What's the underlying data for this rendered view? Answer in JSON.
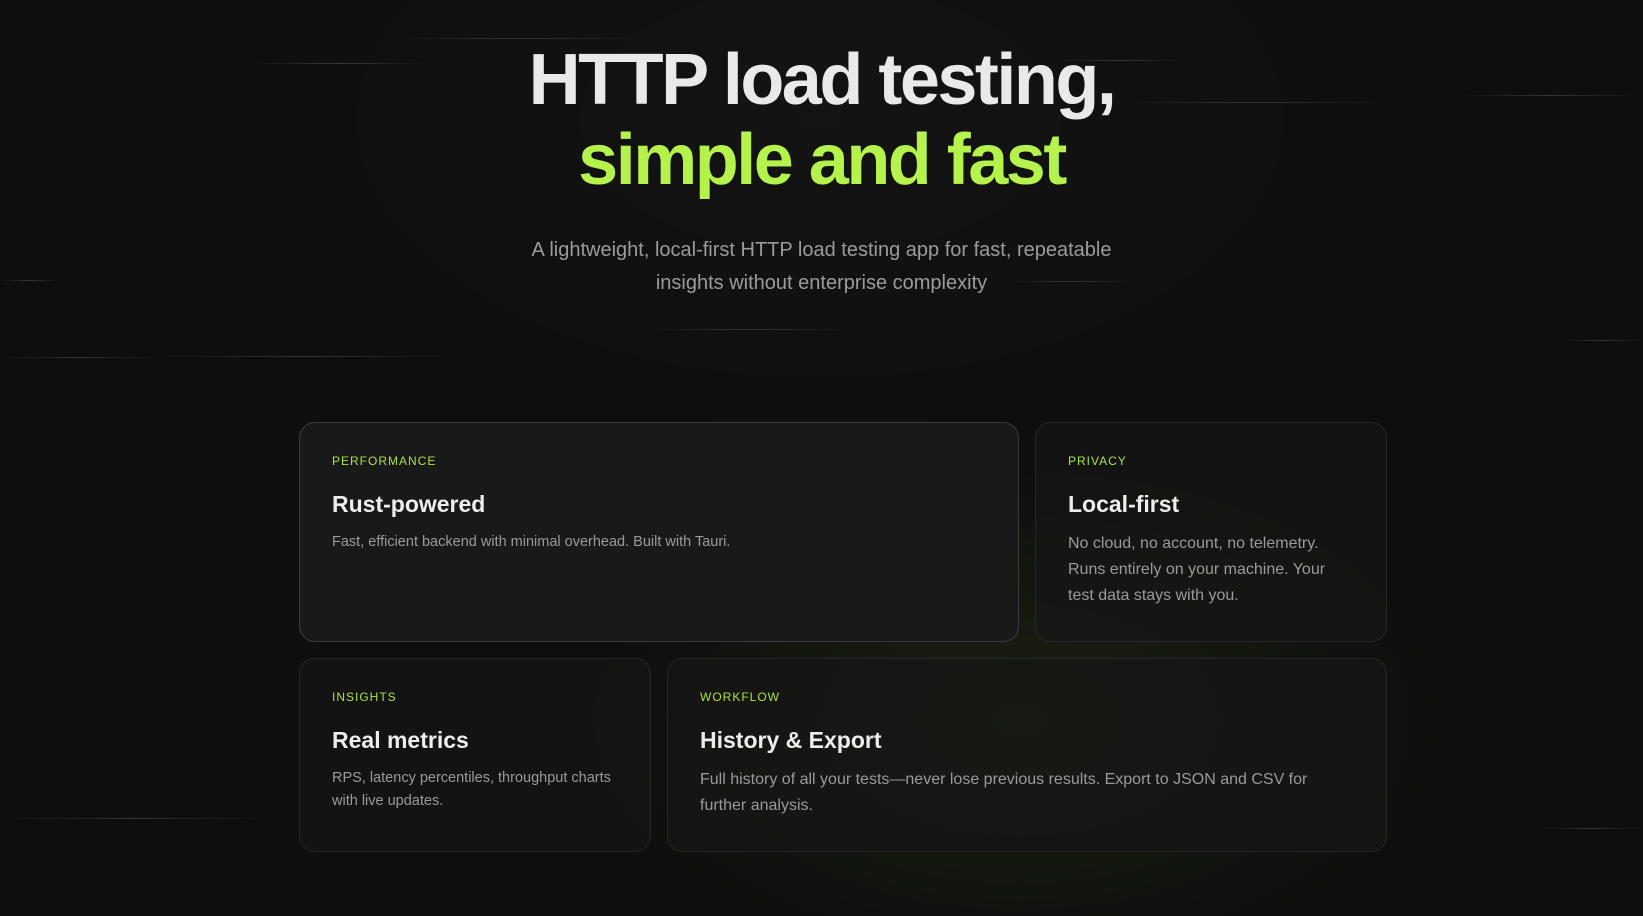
{
  "hero": {
    "title_line1": "HTTP load testing,",
    "title_line2": "simple and fast",
    "subtitle": "A lightweight, local-first HTTP load testing app for fast, repeatable insights without enterprise complexity"
  },
  "colors": {
    "background": "#0e0e0e",
    "accent": "#b5f24b",
    "title_text": "#e9e9e9",
    "muted_text": "#9b9b9b"
  },
  "features": [
    {
      "tag": "PERFORMANCE",
      "title": "Rust-powered",
      "description": "Fast, efficient backend with minimal overhead. Built with Tauri."
    },
    {
      "tag": "PRIVACY",
      "title": "Local-first",
      "description": "No cloud, no account, no telemetry. Runs entirely on your machine. Your test data stays with you."
    },
    {
      "tag": "INSIGHTS",
      "title": "Real metrics",
      "description": "RPS, latency percentiles, throughput charts with live updates."
    },
    {
      "tag": "WORKFLOW",
      "title": "History & Export",
      "description": "Full history of all your tests—never lose previous results. Export to JSON and CSV for further analysis."
    }
  ]
}
